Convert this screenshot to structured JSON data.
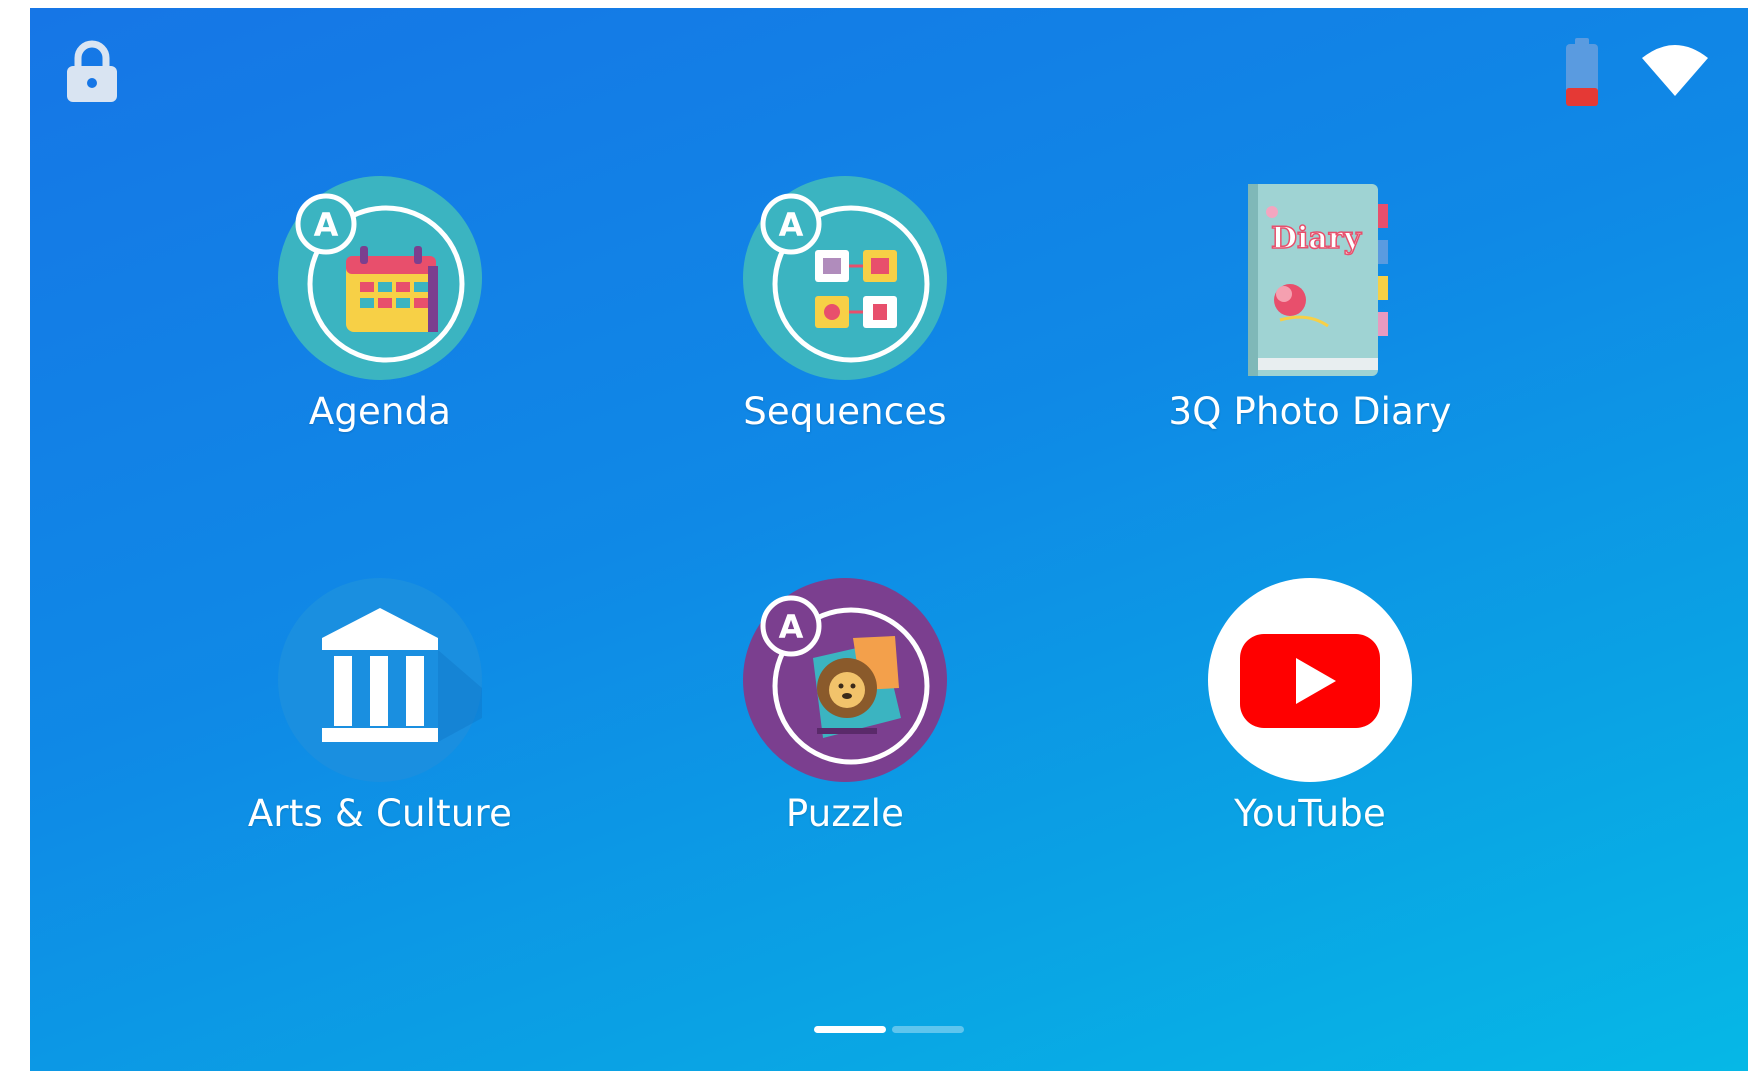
{
  "status_bar": {
    "lock_icon": "lock-icon",
    "battery_icon": "battery-low-icon",
    "wifi_icon": "wifi-icon",
    "battery_color": "#e53935"
  },
  "apps": [
    {
      "label": "Agenda",
      "icon": "agenda-calendar-icon"
    },
    {
      "label": "Sequences",
      "icon": "sequences-icon"
    },
    {
      "label": "3Q Photo Diary",
      "icon": "diary-book-icon",
      "icon_text": "Diary"
    },
    {
      "label": "Arts & Culture",
      "icon": "museum-icon"
    },
    {
      "label": "Puzzle",
      "icon": "lion-puzzle-icon"
    },
    {
      "label": "YouTube",
      "icon": "youtube-icon"
    }
  ],
  "pager": {
    "pages": 2,
    "current": 1
  },
  "colors": {
    "accent_teal": "#3bb4c1",
    "puzzle_purple": "#7b3f8f",
    "youtube_red": "#ff0000"
  }
}
